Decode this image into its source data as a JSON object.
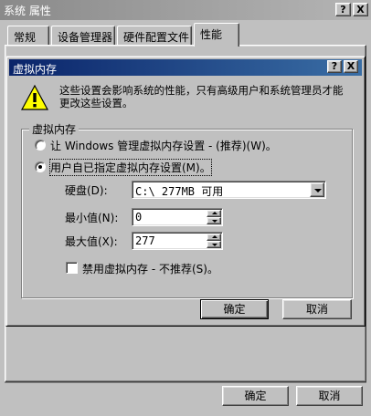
{
  "outer_window": {
    "title": "系统 属性",
    "help_button": "?",
    "close_button": "X"
  },
  "tabs": [
    {
      "label": "常规"
    },
    {
      "label": "设备管理器"
    },
    {
      "label": "硬件配置文件"
    },
    {
      "label": "性能"
    }
  ],
  "active_tab": "性能",
  "dialog": {
    "title": "虚拟内存",
    "help_button": "?",
    "close_button": "X",
    "warning_text_line1": "这些设置会影响系统的性能，只有高级用户和系统管理员才能",
    "warning_text_line2": "更改这些设置。",
    "group_label": "虚拟内存",
    "radio_windows": "让 Windows 管理虚拟内存设置 - (推荐)(W)。",
    "radio_user": "用户自已指定虚拟内存设置(M)。",
    "selected_option": "user",
    "disk_label": "硬盘(D):",
    "disk_value": "C:\\ 277MB 可用",
    "min_label": "最小值(N):",
    "min_value": "0",
    "max_label": "最大值(X):",
    "max_value": "277",
    "disable_checkbox": "禁用虚拟内存 - 不推荐(S)。",
    "disable_checked": false,
    "ok_button": "确定",
    "cancel_button": "取消"
  },
  "outer_ok_button": "确定",
  "outer_cancel_button": "取消",
  "colors": {
    "dialog_title_bg": "#0a246a",
    "inactive_title_bg": "#8a8a8a",
    "face": "#c0c0c0"
  }
}
